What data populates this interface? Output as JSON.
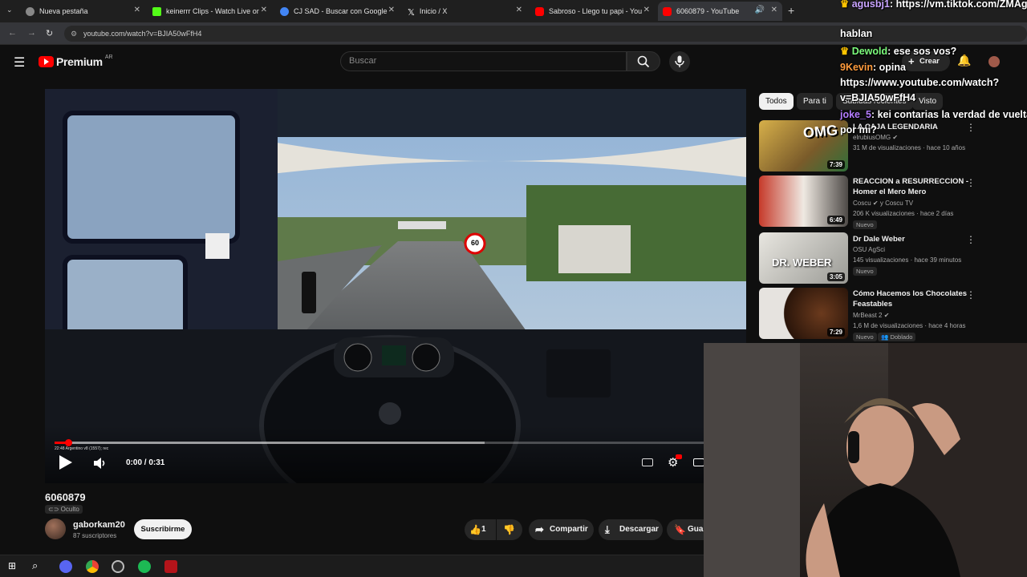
{
  "tabs": [
    {
      "title": "Nueva pestaña"
    },
    {
      "title": "keinerrr Clips - Watch Live on K"
    },
    {
      "title": "CJ SAD - Buscar con Google"
    },
    {
      "title": "Inicio / X"
    },
    {
      "title": "Sabroso - Llego tu papi - YouTu"
    },
    {
      "title": "6060879 - YouTube"
    }
  ],
  "address": {
    "url": "youtube.com/watch?v=BJIA50wFfH4"
  },
  "header": {
    "logo_text": "Premium",
    "region": "AR",
    "search_placeholder": "Buscar",
    "create_label": "Crear"
  },
  "player": {
    "time": "0:00 / 0:31",
    "speed_sign": "60",
    "overlay_text": "22:48 Argentino v8 (1557); rec",
    "progress": 0.02,
    "buffered": 0.63
  },
  "video": {
    "title": "6060879",
    "visibility": "Oculto",
    "channel": "gaborkam20",
    "subscribers": "87 suscriptores",
    "subscribe_label": "Suscribirme",
    "likes": "1",
    "share_label": "Compartir",
    "download_label": "Descargar",
    "save_label": "Guar"
  },
  "chips": [
    "Todos",
    "Para ti",
    "Subidas recientes",
    "Visto"
  ],
  "recommendations": [
    {
      "title": "LA CAJA LEGENDARIA",
      "channel": "elrubiusOMG",
      "meta": "31 M de visualizaciones · hace 10 años",
      "duration": "7:39",
      "thumb_text": "OMG"
    },
    {
      "title": "REACCION a RESURRECCION - Homer el Mero Mero",
      "channel": "Coscu",
      "channel_extra": "y Coscu TV",
      "meta": "206 K visualizaciones · hace 2 días",
      "duration": "6:49",
      "badge": "Nuevo"
    },
    {
      "title": "Dr Dale Weber",
      "channel": "OSU AgSci",
      "meta": "145 visualizaciones · hace 39 minutos",
      "duration": "3:05",
      "badge": "Nuevo",
      "thumb_text": "DR. WEBER"
    },
    {
      "title": "Cómo Hacemos los Chocolates Feastables",
      "channel": "MrBeast 2",
      "meta": "1,6 M de visualizaciones · hace 4 horas",
      "duration": "7:29",
      "badge": "Nuevo",
      "badge2": "Doblado"
    }
  ],
  "chat": [
    {
      "user": "agusbj1",
      "text": "https://vm.tiktok.com/ZMAgtauSB/ te",
      "color": "#c9a4ff",
      "crown": true
    },
    {
      "user": "",
      "text": "hablan",
      "color": "#ffffff"
    },
    {
      "user": "Dewold",
      "text": "ese sos vos?",
      "color": "#7cfc7c",
      "crown": true
    },
    {
      "user": "9Kevin",
      "text": "opina",
      "color": "#ff9b3d"
    },
    {
      "user": "",
      "text": "https://www.youtube.com/watch?",
      "color": "#ffffff"
    },
    {
      "user": "",
      "text": "v=BJIA50wFfH4",
      "color": "#ffffff"
    },
    {
      "user": "joke_5",
      "text": "kei contarias la verdad de vuelta",
      "color": "#b57cff"
    },
    {
      "user": "",
      "text": "por mi?",
      "color": "#ffffff"
    }
  ],
  "colors": {
    "youtube_red": "#ff0000",
    "bg": "#0f0f0f",
    "progress": "#ff0000"
  }
}
